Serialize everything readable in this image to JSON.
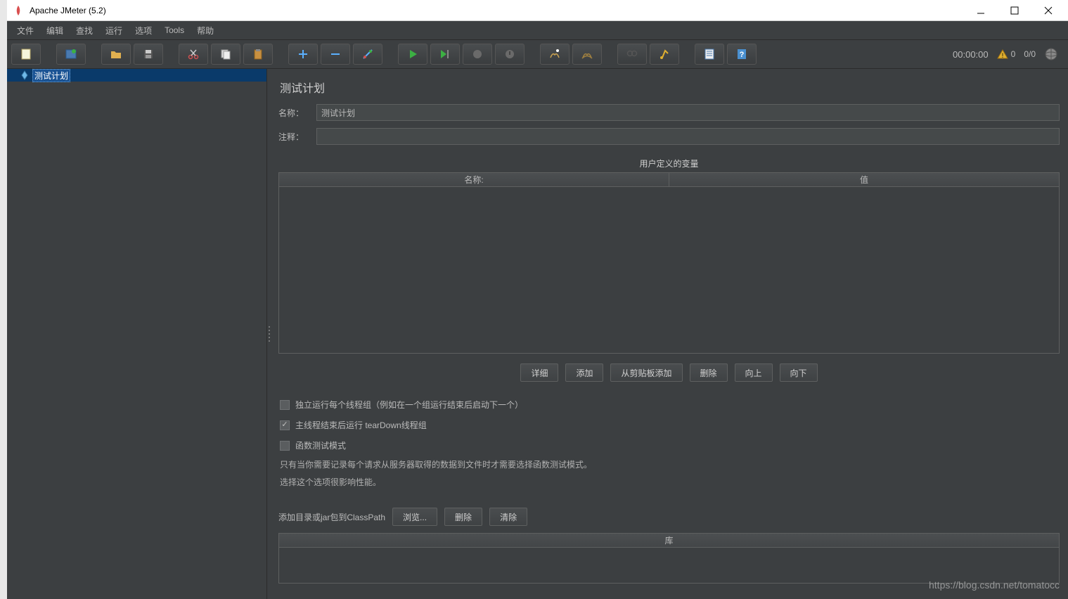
{
  "window": {
    "title": "Apache JMeter (5.2)"
  },
  "menubar": [
    "文件",
    "编辑",
    "查找",
    "运行",
    "选项",
    "Tools",
    "帮助"
  ],
  "status": {
    "timer": "00:00:00",
    "warn_count": "0",
    "thread_counter": "0/0"
  },
  "tree": {
    "root_label": "测试计划"
  },
  "editor": {
    "title": "测试计划",
    "name_label": "名称：",
    "name_value": "测试计划",
    "comment_label": "注释：",
    "comment_value": "",
    "vars_header": "用户定义的变量",
    "col_name": "名称:",
    "col_value": "值",
    "buttons": {
      "detail": "详细",
      "add": "添加",
      "from_clipboard": "从剪贴板添加",
      "delete": "删除",
      "up": "向上",
      "down": "向下"
    },
    "checks": {
      "serial": "独立运行每个线程组（例如在一个组运行结束后启动下一个）",
      "teardown": "主线程结束后运行 tearDown线程组",
      "functional": "函数测试模式"
    },
    "help_line1": "只有当你需要记录每个请求从服务器取得的数据到文件时才需要选择函数测试模式。",
    "help_line2": "选择这个选项很影响性能。",
    "classpath_label": "添加目录或jar包到ClassPath",
    "classpath_buttons": {
      "browse": "浏览...",
      "delete": "删除",
      "clear": "清除"
    },
    "lib_header": "库"
  },
  "watermark": "https://blog.csdn.net/tomatocc"
}
